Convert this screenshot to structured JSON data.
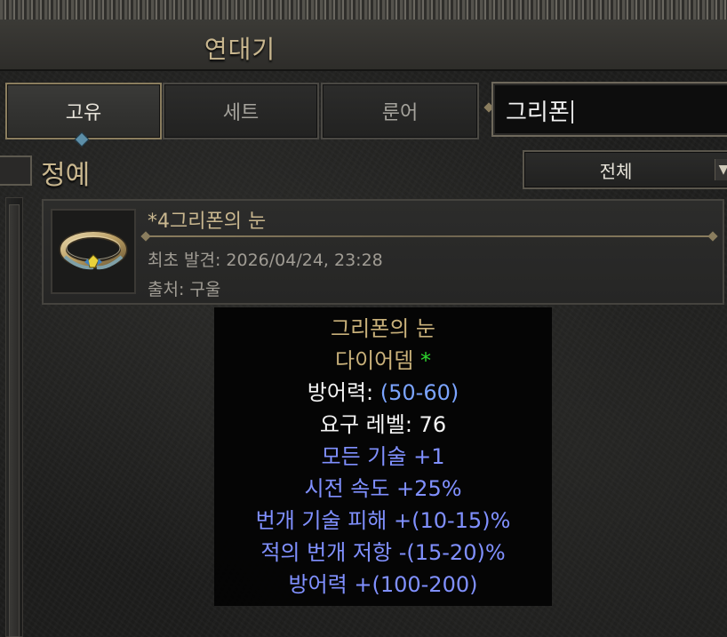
{
  "window": {
    "title": "연대기"
  },
  "tabs": [
    {
      "label": "고유",
      "active": true
    },
    {
      "label": "세트",
      "active": false
    },
    {
      "label": "룬어",
      "active": false
    }
  ],
  "search": {
    "value": "그리폰"
  },
  "group": {
    "title": "정예"
  },
  "filter": {
    "selected": "전체"
  },
  "item": {
    "name": "*4그리폰의 눈",
    "first_found": "최초 발견: 2026/04/24, 23:28",
    "source": "출처: 구울",
    "icon": "diadem-icon"
  },
  "tooltip": {
    "name": "그리폰의 눈",
    "base": "다이어뎀",
    "base_marker": "*",
    "defense_label": "방어력: ",
    "defense_range": "(50-60)",
    "req_level": "요구 레벨: 76",
    "mods": [
      "모든 기술 +1",
      "시전 속도 +25%",
      "번개 기술 피해 +(10-15)%",
      "적의 번개 저항 -(15-20)%",
      "방어력 +(100-200)"
    ]
  },
  "colors": {
    "unique_gold": "#c9b17a",
    "magic_blue": "#8090ff",
    "variable_blue": "#7ba4ff",
    "ethereal_green": "#2fd62f",
    "title_gold": "#c9b78f"
  }
}
